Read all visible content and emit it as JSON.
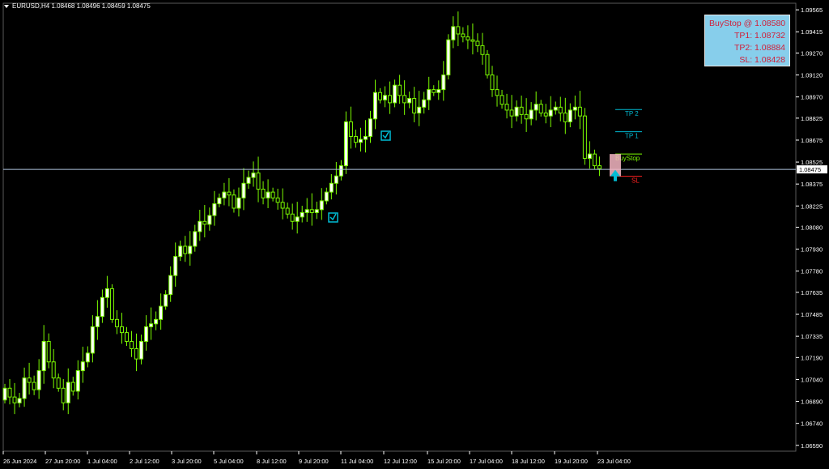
{
  "header": {
    "symbol_line": "EURUSD,H4  1.08468 1.08496 1.08459 1.08475"
  },
  "infobox": {
    "buystop": "BuyStop @ 1.08580",
    "tp1": "TP1: 1.08732",
    "tp2": "TP2: 1.08884",
    "sl": "SL: 1.08428"
  },
  "colors": {
    "background": "#000000",
    "candle": "#7cfc00",
    "bull_body": "#ffffff",
    "axis": "#ffffff",
    "tp_line": "#00bcd4",
    "sl_line": "#ff2020",
    "buystop_line": "#7cfc00",
    "infobox_bg": "#87ceeb",
    "infobox_text": "#d0203a",
    "price_line": "#b0c4de"
  },
  "chart_data": {
    "type": "candlestick",
    "symbol": "EURUSD",
    "timeframe": "H4",
    "current_price": 1.08475,
    "ylim": [
      1.0655,
      1.0961
    ],
    "y_ticks": [
      "1.09565",
      "1.09415",
      "1.09270",
      "1.09120",
      "1.08970",
      "1.08825",
      "1.08675",
      "1.08525",
      "1.08375",
      "1.08225",
      "1.08080",
      "1.07930",
      "1.07780",
      "1.07635",
      "1.07485",
      "1.07335",
      "1.07190",
      "1.07040",
      "1.06890",
      "1.06740",
      "1.06590"
    ],
    "x_ticks": [
      "26 Jun 2024",
      "27 Jun 20:00",
      "1 Jul 04:00",
      "2 Jul 12:00",
      "3 Jul 20:00",
      "5 Jul 04:00",
      "8 Jul 12:00",
      "9 Jul 20:00",
      "11 Jul 04:00",
      "12 Jul 12:00",
      "15 Jul 20:00",
      "17 Jul 04:00",
      "18 Jul 12:00",
      "19 Jul 20:00",
      "23 Jul 04:00"
    ],
    "candles_close": [
      1.0698,
      1.0692,
      1.0688,
      1.0691,
      1.0705,
      1.0702,
      1.0697,
      1.071,
      1.073,
      1.0716,
      1.0705,
      1.0698,
      1.0688,
      1.0702,
      1.0696,
      1.071,
      1.0716,
      1.0722,
      1.074,
      1.0747,
      1.076,
      1.0766,
      1.0745,
      1.074,
      1.0736,
      1.073,
      1.0725,
      1.0718,
      1.073,
      1.074,
      1.0742,
      1.0745,
      1.0754,
      1.0762,
      1.0775,
      1.0788,
      1.0795,
      1.079,
      1.0795,
      1.0805,
      1.0812,
      1.081,
      1.0816,
      1.0824,
      1.0828,
      1.0832,
      1.083,
      1.0821,
      1.0828,
      1.0838,
      1.0842,
      1.0845,
      1.0834,
      1.0828,
      1.0832,
      1.0828,
      1.0825,
      1.0821,
      1.0817,
      1.0812,
      1.0815,
      1.0818,
      1.082,
      1.0818,
      1.082,
      1.0826,
      1.0832,
      1.0838,
      1.0843,
      1.085,
      1.088,
      1.087,
      1.0866,
      1.0868,
      1.087,
      1.0882,
      1.09,
      1.0895,
      1.0898,
      1.0893,
      1.0905,
      1.0898,
      1.0893,
      1.0896,
      1.0886,
      1.089,
      1.0895,
      1.0902,
      1.09,
      1.0902,
      1.0912,
      1.0936,
      1.0945,
      1.094,
      1.0938,
      1.0936,
      1.0935,
      1.0932,
      1.0926,
      1.0912,
      1.0902,
      1.0898,
      1.0892,
      1.0888,
      1.0884,
      1.089,
      1.0885,
      1.0882,
      1.0888,
      1.0892,
      1.0886,
      1.0884,
      1.0888,
      1.089,
      1.0886,
      1.088,
      1.0888,
      1.089,
      1.0884,
      1.0855,
      1.0858,
      1.085,
      1.0848
    ],
    "trade_levels": [
      {
        "label": "TP 2",
        "price": 1.08884
      },
      {
        "label": "TP 1",
        "price": 1.08732
      },
      {
        "label": "BuyStop",
        "price": 1.0858
      },
      {
        "label": "SL",
        "price": 1.08428
      }
    ]
  }
}
